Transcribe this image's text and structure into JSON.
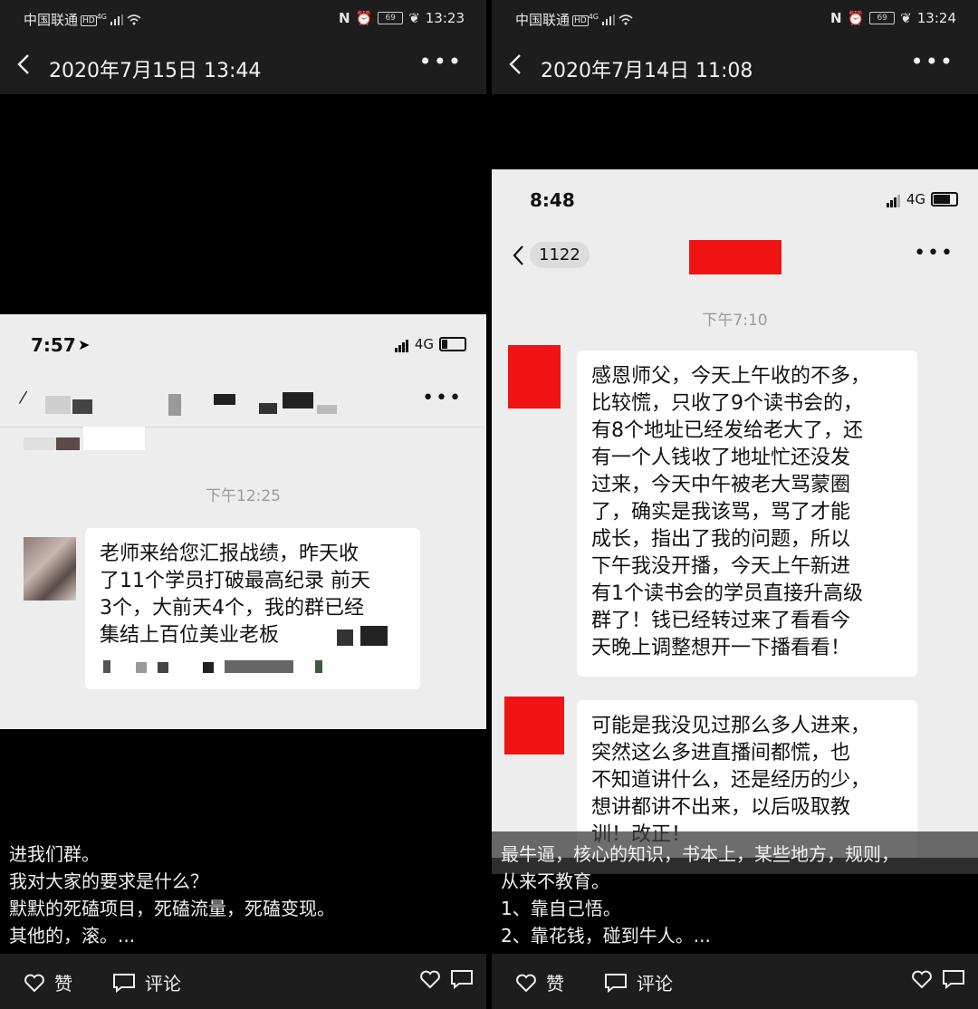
{
  "left": {
    "status": {
      "carrier": "中国联通",
      "hd": "HD",
      "net": "4G",
      "battery": "69",
      "time": "13:23"
    },
    "header": {
      "title": "2020年7月15日 13:44"
    },
    "screenshot": {
      "time": "7:57",
      "network": "4G",
      "timestamp": "下午12:25",
      "message_lines": [
        "老师来给您汇报战绩，昨天收",
        "了11个学员打破最高纪录 前天",
        "3个，大前天4个，我的群已经",
        "集结上百位美业老板"
      ]
    },
    "caption_lines": [
      "进我们群。",
      "我对大家的要求是什么？",
      "默默的死磕项目，死磕流量，死磕变现。",
      "其他的，滚。..."
    ],
    "actions": {
      "like": "赞",
      "comment": "评论"
    }
  },
  "right": {
    "status": {
      "carrier": "中国联通",
      "hd": "HD",
      "net": "4G",
      "battery": "69",
      "time": "13:24"
    },
    "header": {
      "title": "2020年7月14日 11:08"
    },
    "screenshot": {
      "time": "8:48",
      "network": "4G",
      "back_count": "1122",
      "timestamp": "下午7:10",
      "message1_lines": [
        "感恩师父，今天上午收的不多，",
        "比较慌，只收了9个读书会的，",
        "有8个地址已经发给老大了，还",
        "有一个人钱收了地址忙还没发",
        "过来，今天中午被老大骂蒙圈",
        "了，确实是我该骂，骂了才能",
        "成长，指出了我的问题，所以",
        "下午我没开播，今天上午新进",
        "有1个读书会的学员直接升高级",
        "群了！钱已经转过来了看看今",
        "天晚上调整想开一下播看看！"
      ],
      "message2_lines": [
        "可能是我没见过那么多人进来，",
        "突然这么多进直播间都慌，也",
        "不知道讲什么，还是经历的少，",
        "想讲都讲不出来，以后吸取教",
        "训！改正！"
      ]
    },
    "caption_lines": [
      "最牛逼，核心的知识，书本上，某些地方，规则，",
      "从来不教育。",
      "1、靠自己悟。",
      "2、靠花钱，碰到牛人。..."
    ],
    "actions": {
      "like": "赞",
      "comment": "评论"
    }
  },
  "colors": {
    "redaction": "#f01414",
    "bubble": "#ffffff",
    "chat_bg": "#ededed",
    "dark_bar": "#1d1d1d"
  }
}
